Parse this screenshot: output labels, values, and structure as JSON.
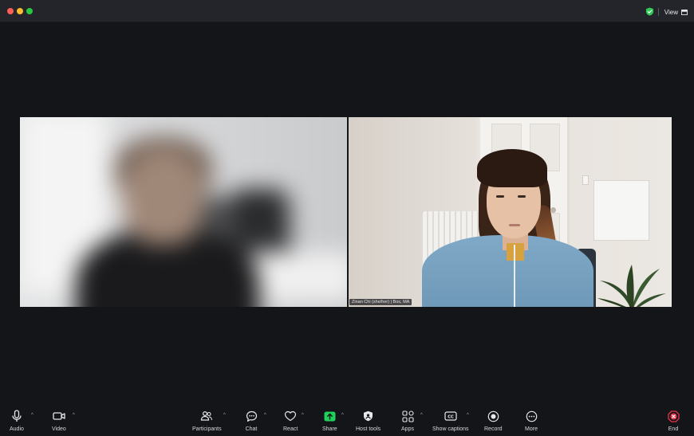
{
  "titlebar": {
    "view_label": "View",
    "icons": {
      "security": "shield-check-icon",
      "view": "view-grid-icon"
    }
  },
  "participants": {
    "right_name_tag": "Zinan Chi (she/her) | Bos, MA"
  },
  "toolbar": {
    "audio": "Audio",
    "video": "Video",
    "participants": "Participants",
    "chat": "Chat",
    "react": "React",
    "share": "Share",
    "host_tools": "Host tools",
    "apps": "Apps",
    "show_captions": "Show captions",
    "record": "Record",
    "more": "More",
    "end": "End"
  },
  "colors": {
    "share_accent": "#1fd15b",
    "end_accent": "#e8354b",
    "security_accent": "#2fc957"
  }
}
